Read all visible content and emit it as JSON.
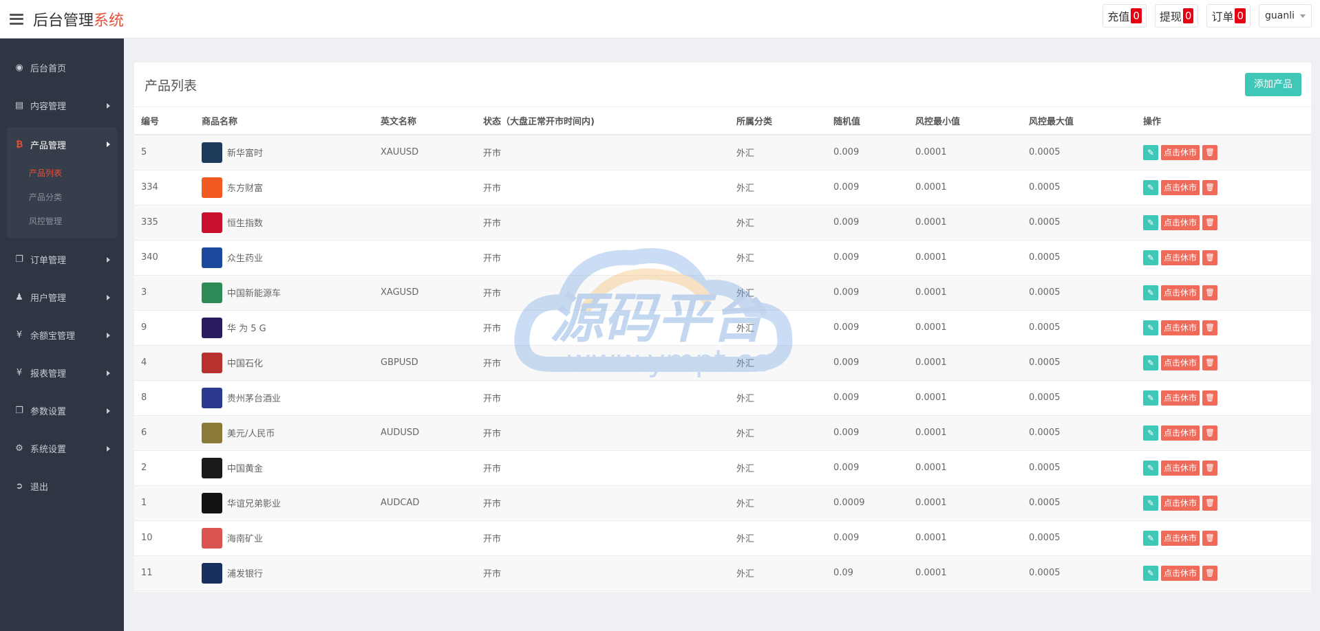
{
  "header": {
    "brand_main": "后台管理",
    "brand_accent": "系统",
    "buttons": [
      {
        "label": "充值",
        "count": "0"
      },
      {
        "label": "提现",
        "count": "0"
      },
      {
        "label": "订单",
        "count": "0"
      }
    ],
    "user": "guanli"
  },
  "sidebar": {
    "items": [
      {
        "label": "后台首页",
        "icon": "dashboard-icon"
      },
      {
        "label": "内容管理",
        "icon": "book-icon"
      },
      {
        "label": "产品管理",
        "icon": "bitcoin-icon"
      },
      {
        "label": "订单管理",
        "icon": "files-icon"
      },
      {
        "label": "用户管理",
        "icon": "user-icon"
      },
      {
        "label": "余额宝管理",
        "icon": "yen-icon"
      },
      {
        "label": "报表管理",
        "icon": "yen-icon"
      },
      {
        "label": "参数设置",
        "icon": "files-icon"
      },
      {
        "label": "系统设置",
        "icon": "gears-icon"
      },
      {
        "label": "退出",
        "icon": "sign-out-icon"
      }
    ],
    "product_sub": [
      "产品列表",
      "产品分类",
      "风控管理"
    ]
  },
  "panel": {
    "title": "产品列表",
    "add_label": "添加产品"
  },
  "table": {
    "headers": [
      "编号",
      "商品名称",
      "英文名称",
      "状态（大盘正常开市时间内)",
      "所属分类",
      "随机值",
      "风控最小值",
      "风控最大值",
      "操作"
    ],
    "status_btn": "点击休市",
    "rows": [
      {
        "id": "5",
        "name": "新华富时",
        "en": "XAUUSD",
        "status": "开市",
        "cat": "外汇",
        "rand": "0.009",
        "min": "0.0001",
        "max": "0.0005",
        "logo": "#1f3b5c"
      },
      {
        "id": "334",
        "name": "东方财富",
        "en": "",
        "status": "开市",
        "cat": "外汇",
        "rand": "0.009",
        "min": "0.0001",
        "max": "0.0005",
        "logo": "#f15a22"
      },
      {
        "id": "335",
        "name": "恒生指数",
        "en": "",
        "status": "开市",
        "cat": "外汇",
        "rand": "0.009",
        "min": "0.0001",
        "max": "0.0005",
        "logo": "#c8102e"
      },
      {
        "id": "340",
        "name": "众生药业",
        "en": "",
        "status": "开市",
        "cat": "外汇",
        "rand": "0.009",
        "min": "0.0001",
        "max": "0.0005",
        "logo": "#1b4a9c"
      },
      {
        "id": "3",
        "name": "中国新能源车",
        "en": "XAGUSD",
        "status": "开市",
        "cat": "外汇",
        "rand": "0.009",
        "min": "0.0001",
        "max": "0.0005",
        "logo": "#2e8b57"
      },
      {
        "id": "9",
        "name": "华 为 5 G",
        "en": "",
        "status": "开市",
        "cat": "外汇",
        "rand": "0.009",
        "min": "0.0001",
        "max": "0.0005",
        "logo": "#2a1a5e"
      },
      {
        "id": "4",
        "name": "中国石化",
        "en": "GBPUSD",
        "status": "开市",
        "cat": "外汇",
        "rand": "0.009",
        "min": "0.0001",
        "max": "0.0005",
        "logo": "#b8312f"
      },
      {
        "id": "8",
        "name": "贵州茅台酒业",
        "en": "",
        "status": "开市",
        "cat": "外汇",
        "rand": "0.009",
        "min": "0.0001",
        "max": "0.0005",
        "logo": "#2b3990"
      },
      {
        "id": "6",
        "name": "美元/人民币",
        "en": "AUDUSD",
        "status": "开市",
        "cat": "外汇",
        "rand": "0.009",
        "min": "0.0001",
        "max": "0.0005",
        "logo": "#8a7a3a"
      },
      {
        "id": "2",
        "name": "中国黄金",
        "en": "",
        "status": "开市",
        "cat": "外汇",
        "rand": "0.009",
        "min": "0.0001",
        "max": "0.0005",
        "logo": "#1a1a1a"
      },
      {
        "id": "1",
        "name": "华谊兄弟影业",
        "en": "AUDCAD",
        "status": "开市",
        "cat": "外汇",
        "rand": "0.0009",
        "min": "0.0001",
        "max": "0.0005",
        "logo": "#111111"
      },
      {
        "id": "10",
        "name": "海南矿业",
        "en": "",
        "status": "开市",
        "cat": "外汇",
        "rand": "0.009",
        "min": "0.0001",
        "max": "0.0005",
        "logo": "#d9534f"
      },
      {
        "id": "11",
        "name": "浦发银行",
        "en": "",
        "status": "开市",
        "cat": "外汇",
        "rand": "0.09",
        "min": "0.0001",
        "max": "0.0005",
        "logo": "#17305f"
      }
    ]
  },
  "watermark": {
    "title": "源码平台",
    "url": "www.ympt.cc"
  }
}
